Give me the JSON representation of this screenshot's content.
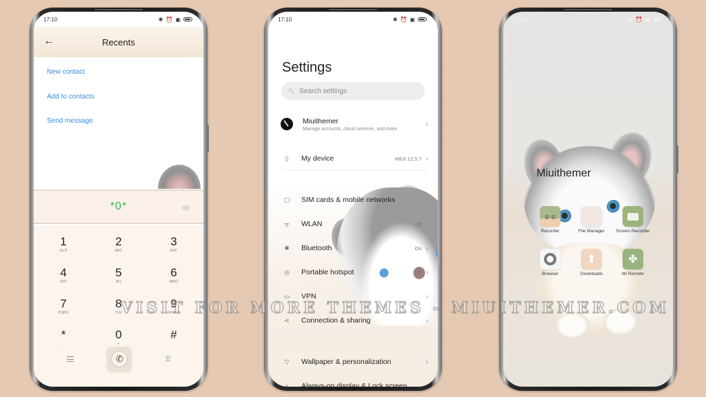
{
  "status_bar": {
    "time": "17:10",
    "icons": [
      "bluetooth-icon",
      "alarm-icon",
      "notification-icon",
      "battery-icon"
    ]
  },
  "dialer": {
    "title": "Recents",
    "back_icon": "arrow-left-icon",
    "actions": [
      "New contact",
      "Add to contacts",
      "Send message"
    ],
    "dialed_number": "*0*",
    "keys": [
      {
        "digit": "1",
        "letters": "GLD"
      },
      {
        "digit": "2",
        "letters": "ABC"
      },
      {
        "digit": "3",
        "letters": "DEF"
      },
      {
        "digit": "4",
        "letters": "GHI"
      },
      {
        "digit": "5",
        "letters": "JKL"
      },
      {
        "digit": "6",
        "letters": "MNO"
      },
      {
        "digit": "7",
        "letters": "PQRS"
      },
      {
        "digit": "8",
        "letters": "TUV"
      },
      {
        "digit": "9",
        "letters": "WXYZ"
      },
      {
        "digit": "*",
        "letters": ","
      },
      {
        "digit": "0",
        "letters": "+"
      },
      {
        "digit": "#",
        "letters": ""
      }
    ],
    "bottom": {
      "menu_icon": "menu-icon",
      "call_icon": "phone-icon",
      "keypad_icon": "keypad-icon"
    },
    "accent_color": "#3ab54a",
    "link_color": "#3d8bd8"
  },
  "settings": {
    "title": "Settings",
    "search_placeholder": "Search settings",
    "items": [
      {
        "label": "Miuithemer",
        "sub": "Manage accounts, cloud services, and more",
        "value": "",
        "icon": "avatar"
      },
      {
        "label": "My device",
        "sub": "",
        "value": "MIUI 12.5.7",
        "icon": "phone-outline-icon"
      },
      {
        "label": "SIM cards & mobile networks",
        "sub": "",
        "value": "",
        "icon": "sim-icon"
      },
      {
        "label": "WLAN",
        "sub": "",
        "value": "Off",
        "icon": "wifi-icon"
      },
      {
        "label": "Bluetooth",
        "sub": "",
        "value": "On",
        "icon": "bluetooth-icon"
      },
      {
        "label": "Portable hotspot",
        "sub": "",
        "value": "Off",
        "icon": "hotspot-icon"
      },
      {
        "label": "VPN",
        "sub": "",
        "value": "",
        "icon": "vpn-icon"
      },
      {
        "label": "Connection & sharing",
        "sub": "",
        "value": "",
        "icon": "share-icon"
      },
      {
        "label": "Wallpaper & personalization",
        "sub": "",
        "value": "",
        "icon": "wallpaper-icon"
      },
      {
        "label": "Always-on display & Lock screen",
        "sub": "",
        "value": "",
        "icon": "lock-icon"
      }
    ]
  },
  "home": {
    "folder_title": "Miuithemer",
    "apps": [
      {
        "label": "Recorder",
        "icon": "recorder-icon"
      },
      {
        "label": "File Manager",
        "icon": "file-manager-icon"
      },
      {
        "label": "Screen Recorder",
        "icon": "screen-recorder-icon"
      },
      {
        "label": "Browser",
        "icon": "browser-icon"
      },
      {
        "label": "Downloads",
        "icon": "downloads-icon"
      },
      {
        "label": "Mi Remote",
        "icon": "mi-remote-icon"
      }
    ]
  },
  "watermark": "VISIT FOR MORE THEMES - MIUITHEMER.COM",
  "colors": {
    "background": "#e6c9b2"
  }
}
